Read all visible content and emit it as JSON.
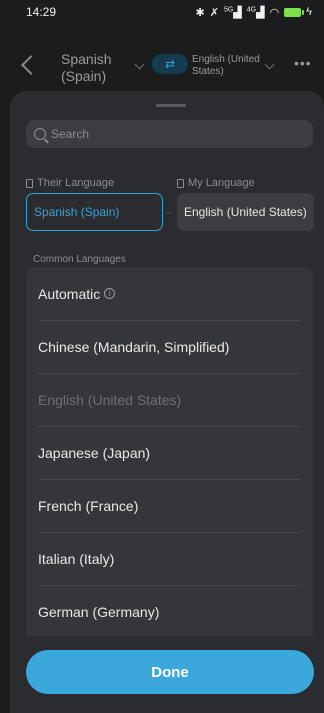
{
  "status_bar": {
    "time": "14:29",
    "icons": [
      "bluetooth-icon",
      "mute-icon",
      "signal-5g-icon",
      "signal-4g-icon",
      "wifi-icon",
      "battery-icon",
      "charging-icon"
    ],
    "network_5g": "5G",
    "network_4g": "4G",
    "battery_color": "#7ee04a"
  },
  "header": {
    "source_language": "Spanish (Spain)",
    "target_language": "English (United States)",
    "swap_icon": "swap-arrows-icon",
    "more_icon": "more-dots-icon"
  },
  "sheet": {
    "search_placeholder": "Search",
    "their_language_label": "Their Language",
    "my_language_label": "My Language",
    "their_language_value": "Spanish (Spain)",
    "my_language_value": "English (United States)",
    "section_label": "Common Languages",
    "languages": [
      {
        "label": "Automatic",
        "disabled": false,
        "info": true
      },
      {
        "label": "Chinese (Mandarin, Simplified)",
        "disabled": false
      },
      {
        "label": "English (United States)",
        "disabled": true
      },
      {
        "label": "Japanese (Japan)",
        "disabled": false
      },
      {
        "label": "French (France)",
        "disabled": false
      },
      {
        "label": "Italian (Italy)",
        "disabled": false
      },
      {
        "label": "German (Germany)",
        "disabled": false
      },
      {
        "label": "",
        "disabled": false
      }
    ],
    "done_label": "Done"
  },
  "colors": {
    "accent": "#3ba8dc",
    "background": "#1b1c1e",
    "sheet": "#2b2c2f"
  }
}
